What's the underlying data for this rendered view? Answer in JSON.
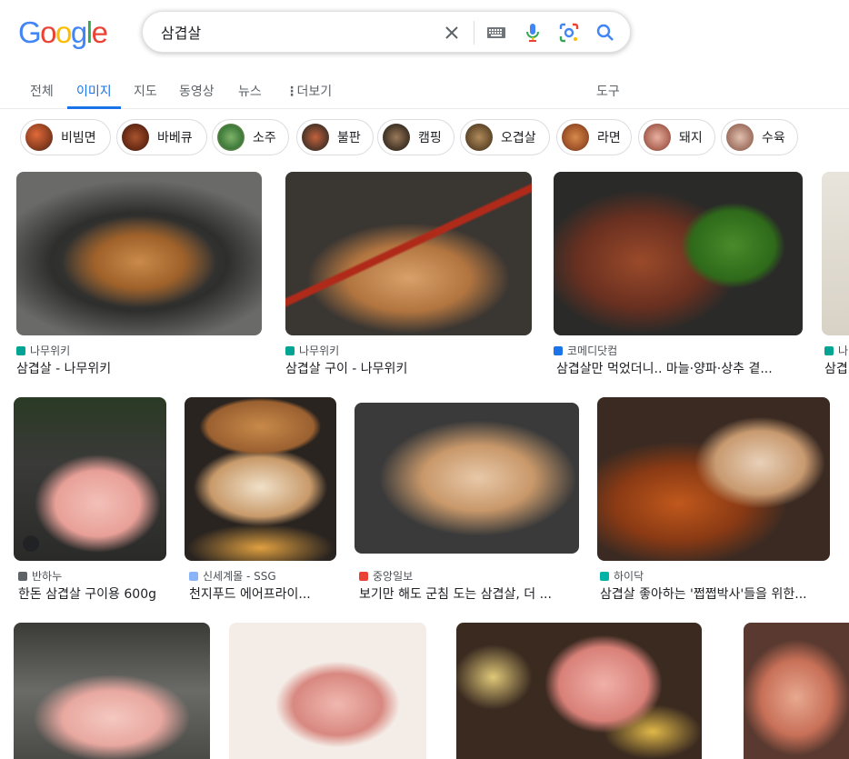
{
  "header": {
    "logo_letters": [
      {
        "ch": "G",
        "color": "#4285F4"
      },
      {
        "ch": "o",
        "color": "#EA4335"
      },
      {
        "ch": "o",
        "color": "#FBBC05"
      },
      {
        "ch": "g",
        "color": "#4285F4"
      },
      {
        "ch": "l",
        "color": "#34A853"
      },
      {
        "ch": "e",
        "color": "#EA4335"
      }
    ],
    "search_value": "삼겹살"
  },
  "tabs": {
    "items": [
      "전체",
      "이미지",
      "지도",
      "동영상",
      "뉴스"
    ],
    "more": "더보기",
    "tools": "도구",
    "active_index": 1,
    "active_color": "#1a73e8"
  },
  "chips": [
    "비빔면",
    "바베큐",
    "소주",
    "불판",
    "캠핑",
    "오겹살",
    "라면",
    "돼지",
    "수육"
  ],
  "results": [
    {
      "source": "나무위키",
      "title": "삼겹살 - 나무위키",
      "fav": "#00a495"
    },
    {
      "source": "나무위키",
      "title": "삼겹살 구이 - 나무위키",
      "fav": "#00a495"
    },
    {
      "source": "코메디닷컴",
      "title": "삼겹살만 먹었더니.. 마늘·양파·상추 곁...",
      "fav": "#1a73e8"
    },
    {
      "source": "나",
      "title": "삼겹",
      "fav": "#00a495"
    },
    {
      "source": "반하누",
      "title": "한돈 삼겹살 구이용 600g",
      "fav": "#5f6368"
    },
    {
      "source": "신세계몰 - SSG",
      "title": "천지푸드 에어프라이...",
      "fav": "#8ab4f8"
    },
    {
      "source": "중앙일보",
      "title": "보기만 해도 군침 도는 삼겹살, 더 ...",
      "fav": "#ea4335"
    },
    {
      "source": "하이닥",
      "title": "삼겹살 좋아하는 '쩝쩝박사'들을 위한...",
      "fav": "#00b3a4"
    }
  ]
}
